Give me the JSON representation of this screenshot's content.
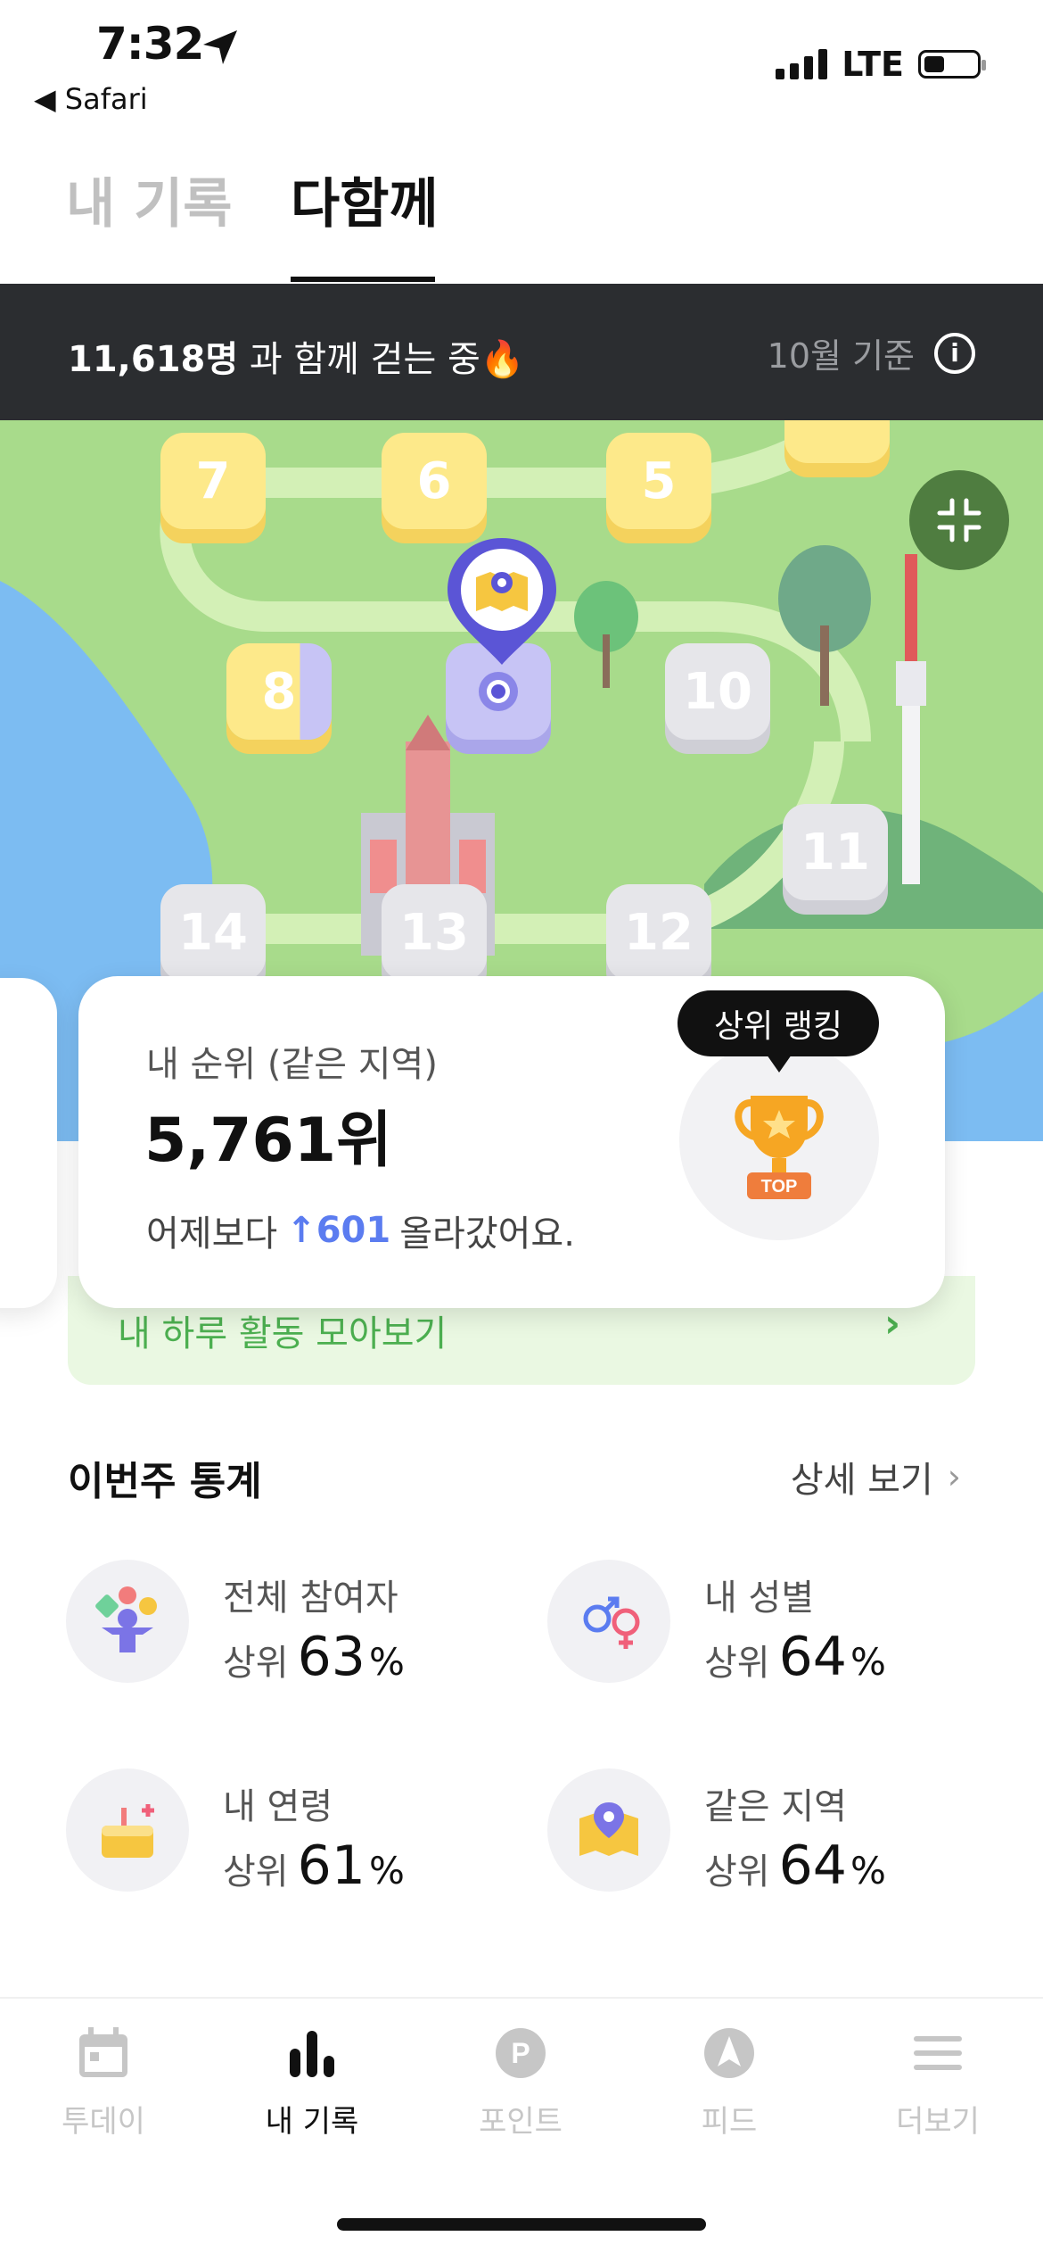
{
  "status_bar": {
    "time": "7:32",
    "back_app": "◀ Safari",
    "network": "LTE"
  },
  "top_tabs": [
    {
      "label": "내 기록",
      "active": false
    },
    {
      "label": "다함께",
      "active": true
    }
  ],
  "banner": {
    "count": "11,618명",
    "text": " 과 함께 걷는 중🔥",
    "period": "10월 기준",
    "info_icon": "info-icon"
  },
  "map": {
    "tiles": [
      "7",
      "6",
      "5",
      "8",
      "10",
      "11",
      "14",
      "13",
      "12"
    ],
    "current_marker_icon": "map-pin-icon",
    "collapse_icon": "collapse-icon"
  },
  "rank_card": {
    "label": "내 순위 (같은 지역)",
    "value": "5,761위",
    "change_prefix": "어제보다",
    "change_value": "↑601",
    "change_suffix": "올라갔어요.",
    "tooltip": "상위 랭킹",
    "trophy_text": "TOP"
  },
  "daily": {
    "label": "내 하루 활동 모아보기"
  },
  "stats": {
    "title": "이번주 통계",
    "detail": "상세 보기",
    "items": [
      {
        "label": "전체 참여자",
        "prefix": "상위",
        "value": "63",
        "unit": "%"
      },
      {
        "label": "내 성별",
        "prefix": "상위",
        "value": "64",
        "unit": "%"
      },
      {
        "label": "내 연령",
        "prefix": "상위",
        "value": "61",
        "unit": "%"
      },
      {
        "label": "같은 지역",
        "prefix": "상위",
        "value": "64",
        "unit": "%"
      }
    ]
  },
  "bottom_nav": [
    {
      "label": "투데이",
      "icon": "calendar-icon",
      "active": false
    },
    {
      "label": "내 기록",
      "icon": "bar-chart-icon",
      "active": true
    },
    {
      "label": "포인트",
      "icon": "point-icon",
      "active": false
    },
    {
      "label": "피드",
      "icon": "compass-icon",
      "active": false
    },
    {
      "label": "더보기",
      "icon": "menu-icon",
      "active": false
    }
  ],
  "colors": {
    "accent_blue": "#5b7cf0",
    "banner_bg": "#2b2d30",
    "green": "#4caf50",
    "map_green": "#a8db8b"
  }
}
